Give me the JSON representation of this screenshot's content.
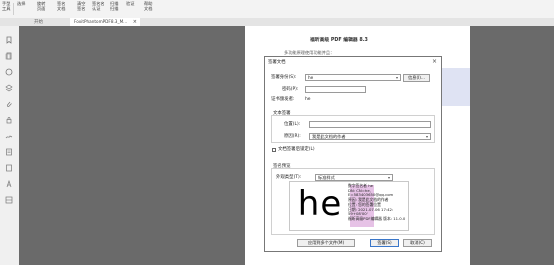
{
  "toolbar": {
    "items": [
      {
        "top": "手型",
        "bottom": "工具",
        "icon": "hand-icon"
      },
      {
        "top": "选择",
        "bottom": "",
        "icon": "select-icon"
      },
      {
        "top": "旋转",
        "bottom": "页面",
        "icon": "rotate-icon"
      },
      {
        "top": "签名",
        "bottom": "文档",
        "icon": "sign-icon"
      },
      {
        "top": "清空",
        "bottom": "签名",
        "icon": "clear-icon"
      },
      {
        "top": "签名名",
        "bottom": "认证",
        "icon": "cert-icon"
      },
      {
        "top": "扫描",
        "bottom": "扫描",
        "icon": "scan-icon"
      },
      {
        "top": "验证",
        "bottom": "",
        "icon": "verify-icon"
      },
      {
        "top": "帮助",
        "bottom": "文档",
        "icon": "help-icon"
      }
    ]
  },
  "tabs": {
    "start_label": "开始",
    "doc_label": "FoxitPhantomPDF8.3_M...",
    "close_glyph": "×"
  },
  "page": {
    "title": "福昕高级 PDF 编辑器 8.3",
    "subtitle": "多功能原理使用功能并且："
  },
  "dialog": {
    "title": "签署文档",
    "close_glyph": "×",
    "sign_as_label": "签署身份(S):",
    "sign_as_value": "he",
    "info_button": "信息(I)...",
    "password_label": "密码(P):",
    "issuer_label": "证书颁发者:",
    "issuer_value": "he",
    "text_section": "文本签署",
    "location_label": "位置(L):",
    "reason_label": "原因(R):",
    "reason_value": "我是此文档的作者",
    "lock_label": "文档签署后锁定(L)",
    "appearance_section": "签名预览",
    "appearance_type_label": "外观类型(T):",
    "appearance_type_value": "标准样式",
    "preview_big_text": "he",
    "preview_lines": [
      "数字签名者 he",
      "DN: CN=he,",
      "E=583403650@qq.com",
      "原因: 我是此文档的作者",
      "位置: 您的签署位置",
      "日期: 2021.07.06 17:42:",
      "59+08'00'",
      "福昕高级PDF编辑器 版本: 11.0.0"
    ],
    "apply_button": "应用到多个文件(M)",
    "sign_button": "签署(S)",
    "cancel_button": "取消(C)"
  }
}
